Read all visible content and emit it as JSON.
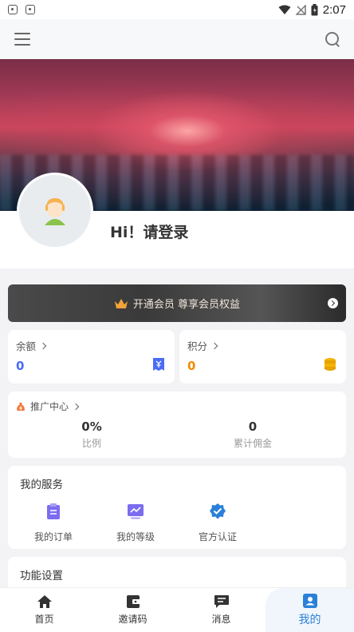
{
  "status_bar": {
    "time": "2:07"
  },
  "header": {
    "menu_icon": "menu-icon",
    "search_icon": "search-icon"
  },
  "profile": {
    "greeting": "Hi！请登录"
  },
  "vip": {
    "text": "开通会员 尊享会员权益"
  },
  "balance": {
    "label": "余额",
    "value": "0"
  },
  "points": {
    "label": "积分",
    "value": "0"
  },
  "promotion": {
    "title": "推广中心",
    "ratio_value": "0%",
    "ratio_label": "比例",
    "commission_value": "0",
    "commission_label": "累计佣金"
  },
  "services": {
    "title": "我的服务",
    "items": [
      {
        "label": "我的订单",
        "icon": "clipboard-icon"
      },
      {
        "label": "我的等级",
        "icon": "chart-icon"
      },
      {
        "label": "官方认证",
        "icon": "verified-badge-icon"
      }
    ]
  },
  "settings": {
    "title": "功能设置"
  },
  "nav": {
    "items": [
      {
        "label": "首页",
        "icon": "home-icon"
      },
      {
        "label": "邀请码",
        "icon": "wallet-icon"
      },
      {
        "label": "消息",
        "icon": "message-icon"
      },
      {
        "label": "我的",
        "icon": "profile-icon"
      }
    ],
    "active_index": 3
  },
  "colors": {
    "accent_blue": "#2a80d8",
    "balance_blue": "#4a6cf7",
    "points_orange": "#f08c00",
    "service_purple": "#7c6cf0"
  }
}
